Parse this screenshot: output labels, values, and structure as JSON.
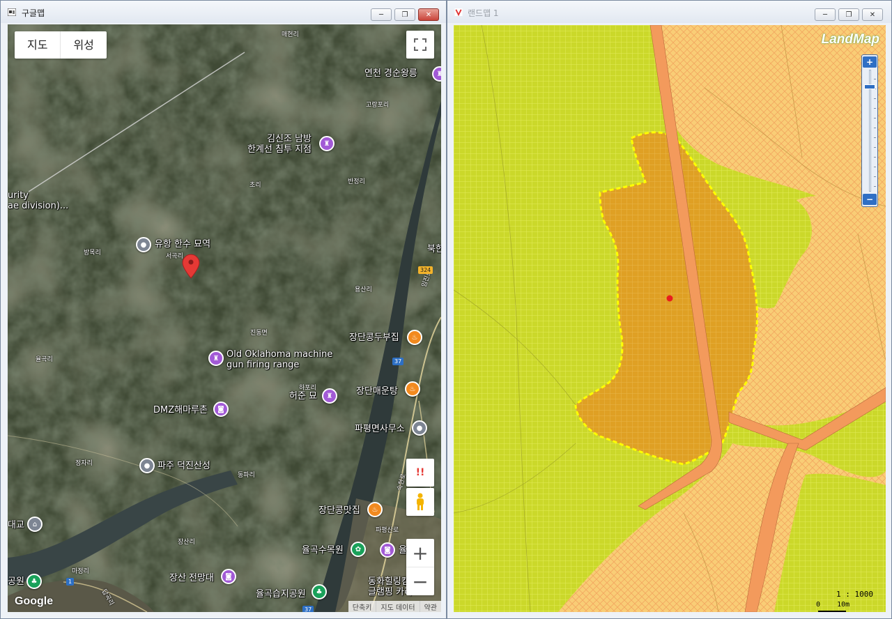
{
  "left_window": {
    "title": "구글맵",
    "map_type": [
      "지도",
      "위성"
    ],
    "window_buttons": [
      "─",
      "❐",
      "✕"
    ],
    "pois": [
      {
        "name": "연천 경순왕릉",
        "icon": "landmark-icon"
      },
      {
        "name": "김신조 남방\n한계선 침투 지점",
        "icon": "landmark-icon"
      },
      {
        "name": "유항 한수 묘역",
        "icon": "place-icon"
      },
      {
        "name": "Old Oklahoma machine\ngun firing range",
        "icon": "landmark-icon"
      },
      {
        "name": "허준 묘",
        "icon": "landmark-icon"
      },
      {
        "name": "DMZ해마루촌",
        "icon": "camera-icon"
      },
      {
        "name": "파주 덕진산성",
        "icon": "place-icon"
      },
      {
        "name": "장단콩두부집",
        "icon": "restaurant-icon"
      },
      {
        "name": "장단매운탕",
        "icon": "restaurant-icon"
      },
      {
        "name": "파평면사무소",
        "icon": "place-icon"
      },
      {
        "name": "장단콩맛집",
        "icon": "restaurant-icon"
      },
      {
        "name": "율곡수목원",
        "icon": "park-icon"
      },
      {
        "name": "장산 전망대",
        "icon": "camera-icon"
      },
      {
        "name": "율곡습지공원",
        "icon": "park-icon"
      },
      {
        "name": "동화힐링캠\n글램핑 카라",
        "icon": "park-icon"
      }
    ],
    "villages": [
      "매현리",
      "고랑포리",
      "초리",
      "반정리",
      "방목리",
      "서곡리",
      "용산리",
      "진동면",
      "하포리",
      "정자리",
      "동파리",
      "장산리",
      "마정리",
      "율곡리",
      "파평산로",
      "임진로",
      "숙현로",
      "답곡리",
      "북한"
    ],
    "partial_labels": [
      "urity\nae division)...",
      "대교",
      "공원",
      "율"
    ],
    "road_shields": [
      "324",
      "37",
      "1",
      "37"
    ],
    "google_logo": "Google",
    "attribution": [
      "단축키",
      "지도 데이터",
      "약관"
    ]
  },
  "right_window": {
    "title": "랜드맵 1",
    "window_buttons": [
      "─",
      "❐",
      "✕"
    ],
    "logo": "LandMap",
    "zoom_in": "+",
    "zoom_out": "−",
    "scale_text": "1 : 1000",
    "scale_bar": "0    10m"
  },
  "colors": {
    "green_zone": "#cbd82a",
    "orange_zone": "#f9cd76",
    "parcel_fill": "#e0a020",
    "parcel_border": "#ffff00",
    "road": "#f39a5c",
    "marker": "#e81e1e",
    "gmap_pin": "#e53935"
  }
}
